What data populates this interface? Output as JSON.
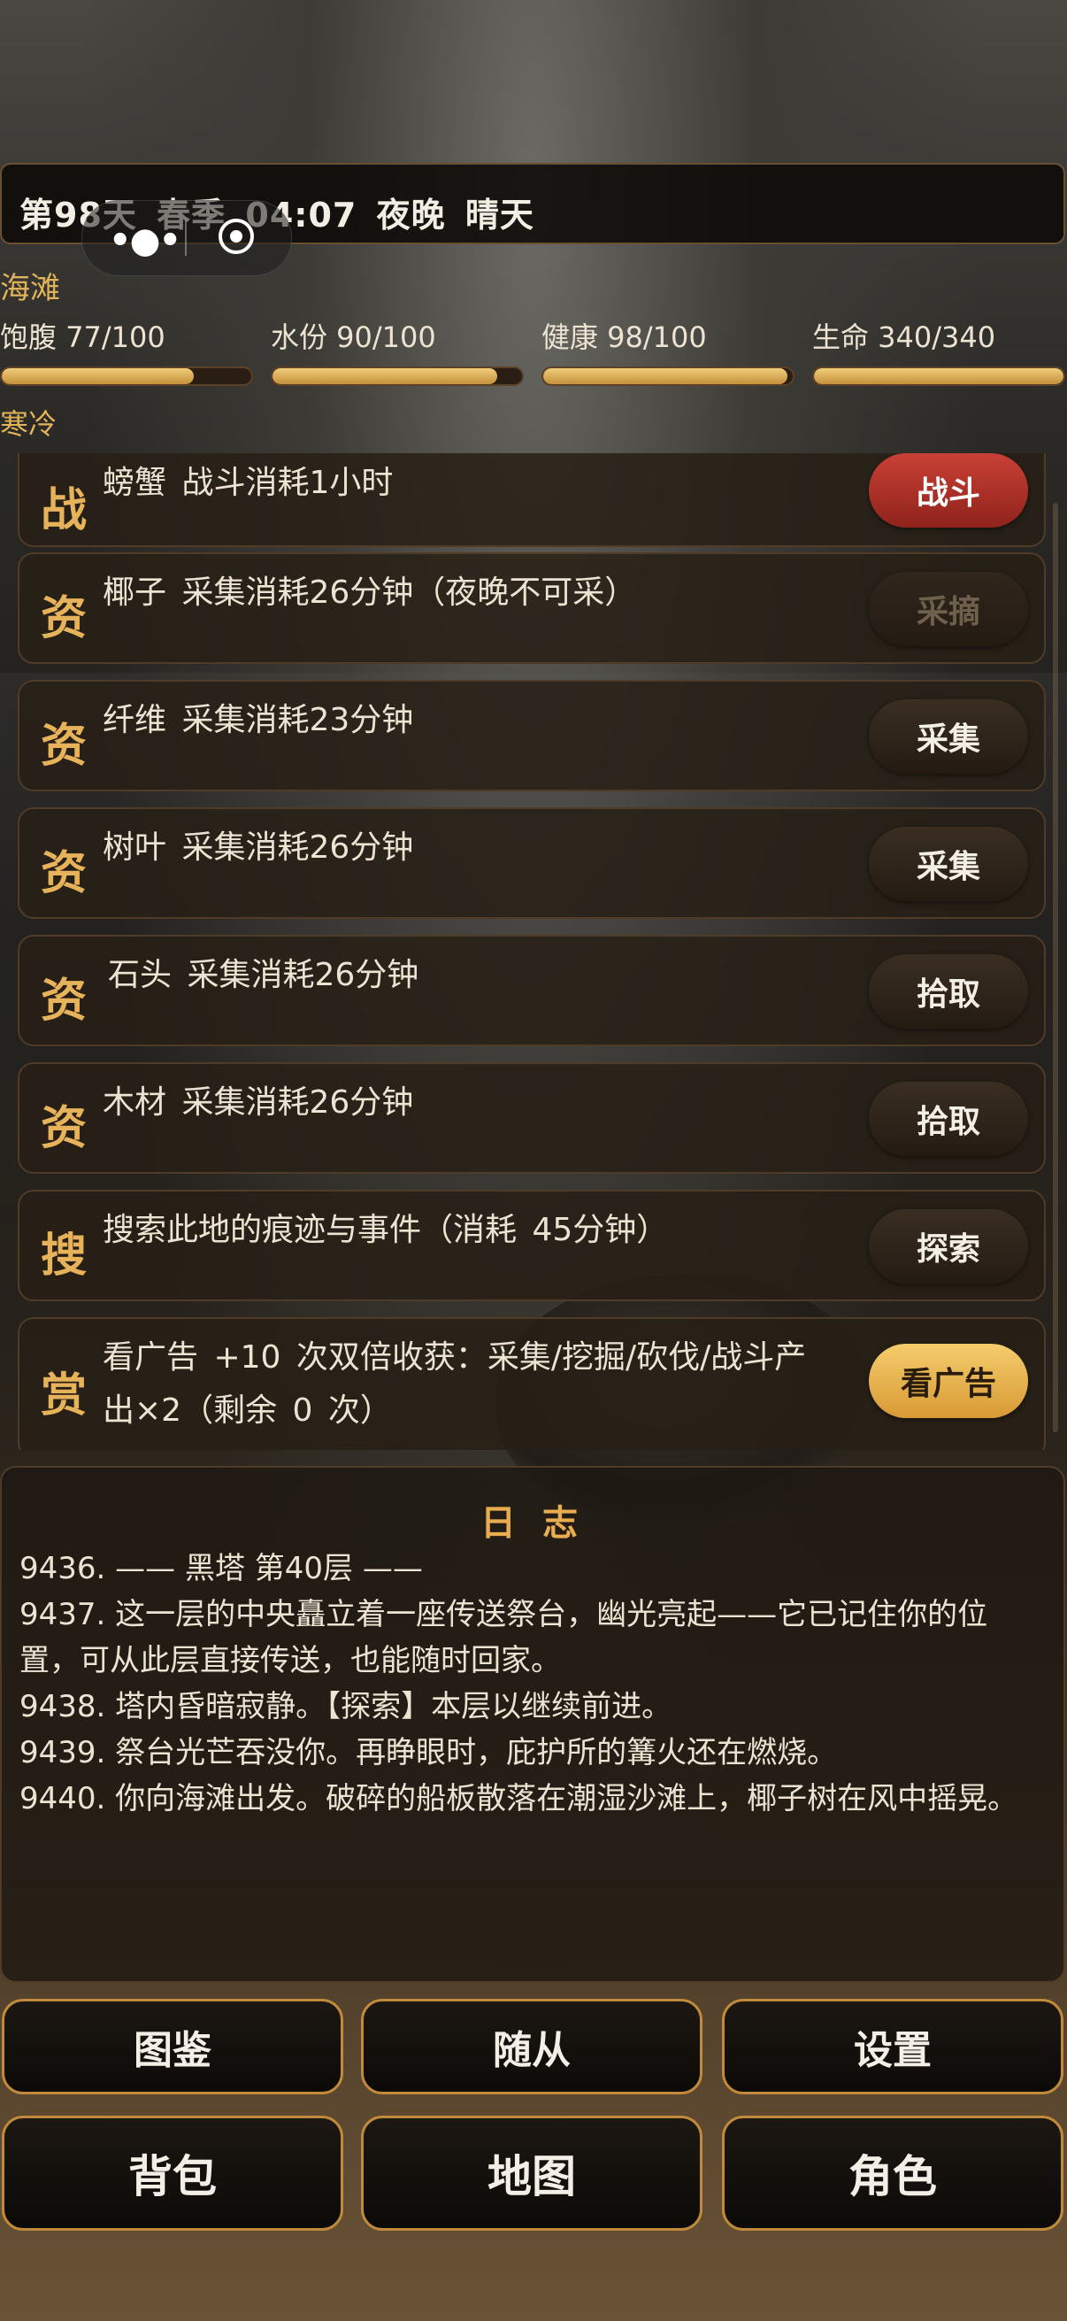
{
  "status": {
    "day": "第98天",
    "season": "春季",
    "time": "04:07",
    "period": "夜晚",
    "weather": "晴天"
  },
  "location": "海滩",
  "temperature": "寒冷",
  "stats": [
    {
      "label": "饱腹 77/100",
      "value": 77,
      "max": 100
    },
    {
      "label": "水份 90/100",
      "value": 90,
      "max": 100
    },
    {
      "label": "健康 98/100",
      "value": 98,
      "max": 100
    },
    {
      "label": "生命 340/340",
      "value": 340,
      "max": 340
    }
  ],
  "actions": [
    {
      "icon": "战",
      "text": "螃蟹  战斗消耗1小时",
      "button": "战斗"
    },
    {
      "icon": "资",
      "text": "椰子  采集消耗26分钟（夜晚不可采）",
      "button": "采摘"
    },
    {
      "icon": "资",
      "text": "纤维  采集消耗23分钟",
      "button": "采集"
    },
    {
      "icon": "资",
      "text": "树叶  采集消耗26分钟",
      "button": "采集"
    },
    {
      "icon": "资",
      "text": "石头  采集消耗26分钟",
      "button": "拾取"
    },
    {
      "icon": "资",
      "text": "木材  采集消耗26分钟",
      "button": "拾取"
    },
    {
      "icon": "搜",
      "text": "搜索此地的痕迹与事件（消耗 45分钟）",
      "button": "探索"
    },
    {
      "icon": "赏",
      "text": "看广告 +10 次双倍收获：采集/挖掘/砍伐/战斗产出×2（剩余 0 次）",
      "button": "看广告"
    }
  ],
  "log": {
    "title": "日 志",
    "entries": [
      "9436. —— 黑塔 第40层 ——",
      "9437. 这一层的中央矗立着一座传送祭台，幽光亮起——它已记住你的位置，可从此层直接传送，也能随时回家。",
      "9438. 塔内昏暗寂静。【探索】本层以继续前进。",
      "9439. 祭台光芒吞没你。再睁眼时，庇护所的篝火还在燃烧。",
      "9440. 你向海滩出发。破碎的船板散落在潮湿沙滩上，椰子树在风中摇晃。"
    ]
  },
  "nav": {
    "codex": "图鉴",
    "followers": "随从",
    "settings": "设置",
    "backpack": "背包",
    "map": "地图",
    "character": "角色"
  },
  "capsule": {
    "more_icon": "•●•",
    "close_icon": "target-circle"
  }
}
